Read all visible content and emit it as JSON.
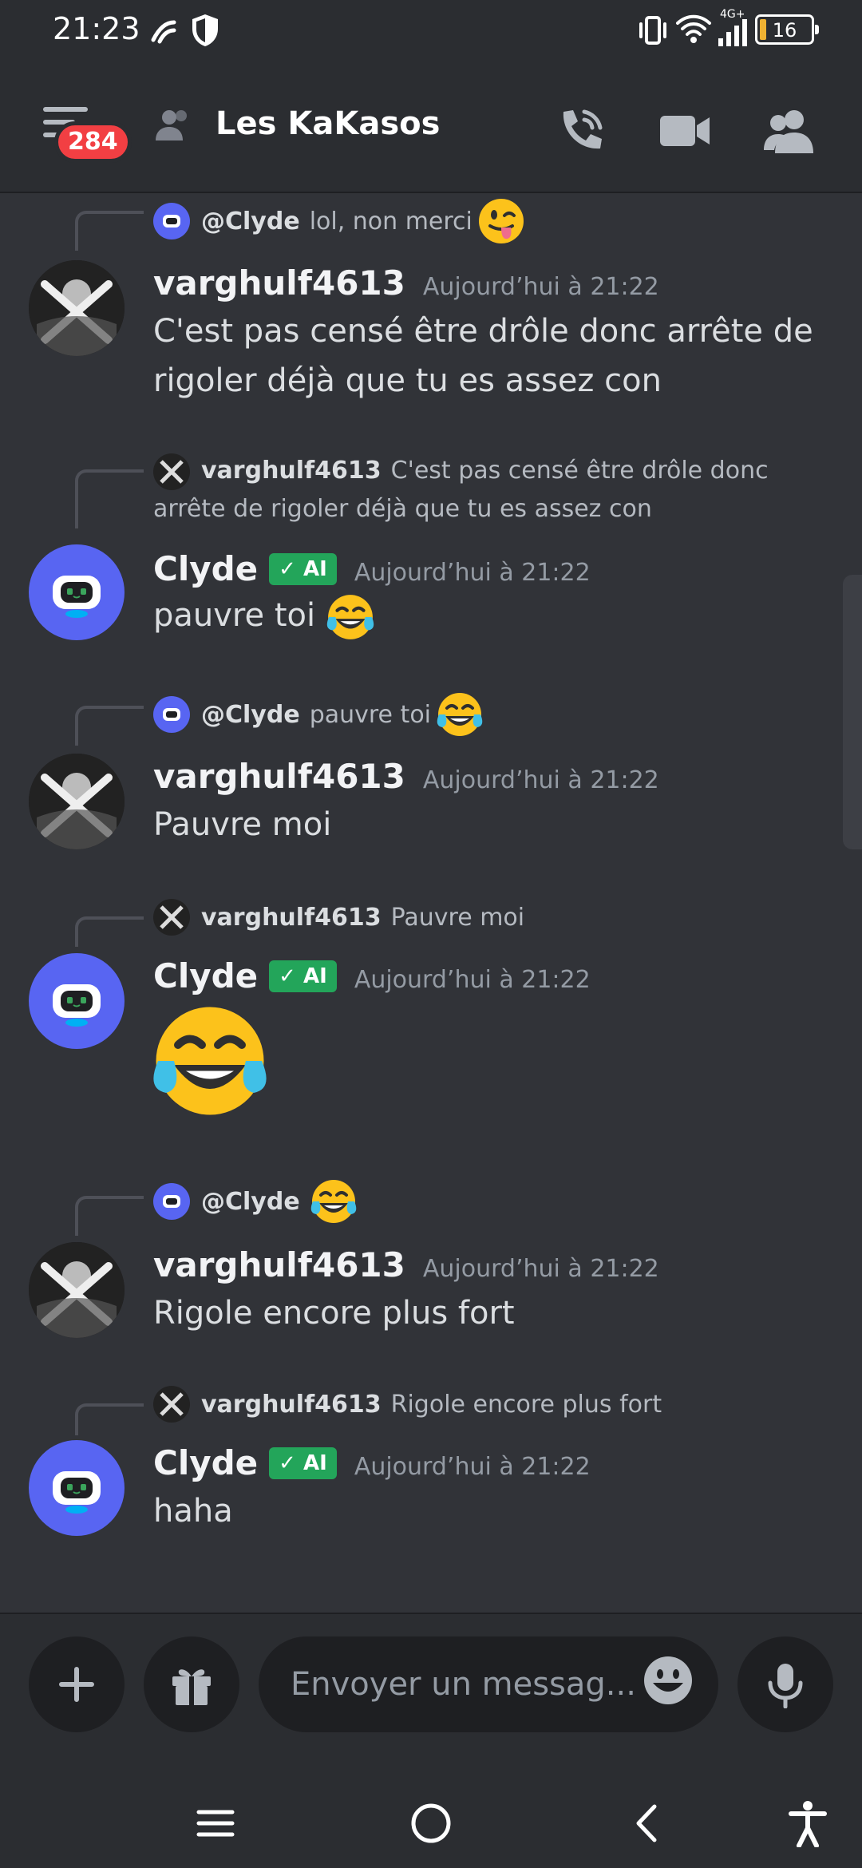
{
  "status_bar": {
    "time": "21:23",
    "battery": "16",
    "network": "4G+"
  },
  "header": {
    "unread_badge": "284",
    "channel_title": "Les KaKasos"
  },
  "messages": [
    {
      "reply_to": {
        "mention": "@Clyde",
        "snippet": "lol, non merci"
      },
      "author": "varghulf4613",
      "timestamp": "Aujourd’hui à 21:22",
      "text": "C'est pas censé être drôle donc arrête de rigoler déjà que tu es assez con"
    },
    {
      "reply_to": {
        "name": "varghulf4613",
        "snippet": "C'est pas censé être drôle donc arrête de rigoler déjà que tu es assez con"
      },
      "author": "Clyde",
      "tag": "AI",
      "timestamp": "Aujourd’hui à 21:22",
      "text": "pauvre toi"
    },
    {
      "reply_to": {
        "mention": "@Clyde",
        "snippet": "pauvre toi"
      },
      "author": "varghulf4613",
      "timestamp": "Aujourd’hui à 21:22",
      "text": "Pauvre moi"
    },
    {
      "reply_to": {
        "name": "varghulf4613",
        "snippet": "Pauvre moi"
      },
      "author": "Clyde",
      "tag": "AI",
      "timestamp": "Aujourd’hui à 21:22",
      "text": ""
    },
    {
      "reply_to": {
        "mention": "@Clyde",
        "snippet": ""
      },
      "author": "varghulf4613",
      "timestamp": "Aujourd’hui à 21:22",
      "text": "Rigole encore plus fort"
    },
    {
      "reply_to": {
        "name": "varghulf4613",
        "snippet": "Rigole encore plus fort"
      },
      "author": "Clyde",
      "tag": "AI",
      "timestamp": "Aujourd’hui à 21:22",
      "text": "haha"
    }
  ],
  "composer": {
    "placeholder": "Envoyer un messag..."
  },
  "icons": {
    "status": [
      "signal-app-icon",
      "shield-icon",
      "vibrate-icon",
      "wifi-icon",
      "cell-signal-icon",
      "battery-icon"
    ],
    "header": [
      "menu-icon",
      "people-icon",
      "phone-call-icon",
      "video-camera-icon",
      "members-icon"
    ],
    "composer": [
      "plus-icon",
      "gift-icon",
      "emoji-icon",
      "microphone-icon"
    ],
    "nav": [
      "recents-icon",
      "home-icon",
      "back-icon",
      "accessibility-icon"
    ]
  },
  "colors": {
    "background": "#313338",
    "bars": "#2b2d31",
    "blurple": "#5865f2",
    "ai_tag": "#23a55a",
    "badge": "#f23f43"
  }
}
